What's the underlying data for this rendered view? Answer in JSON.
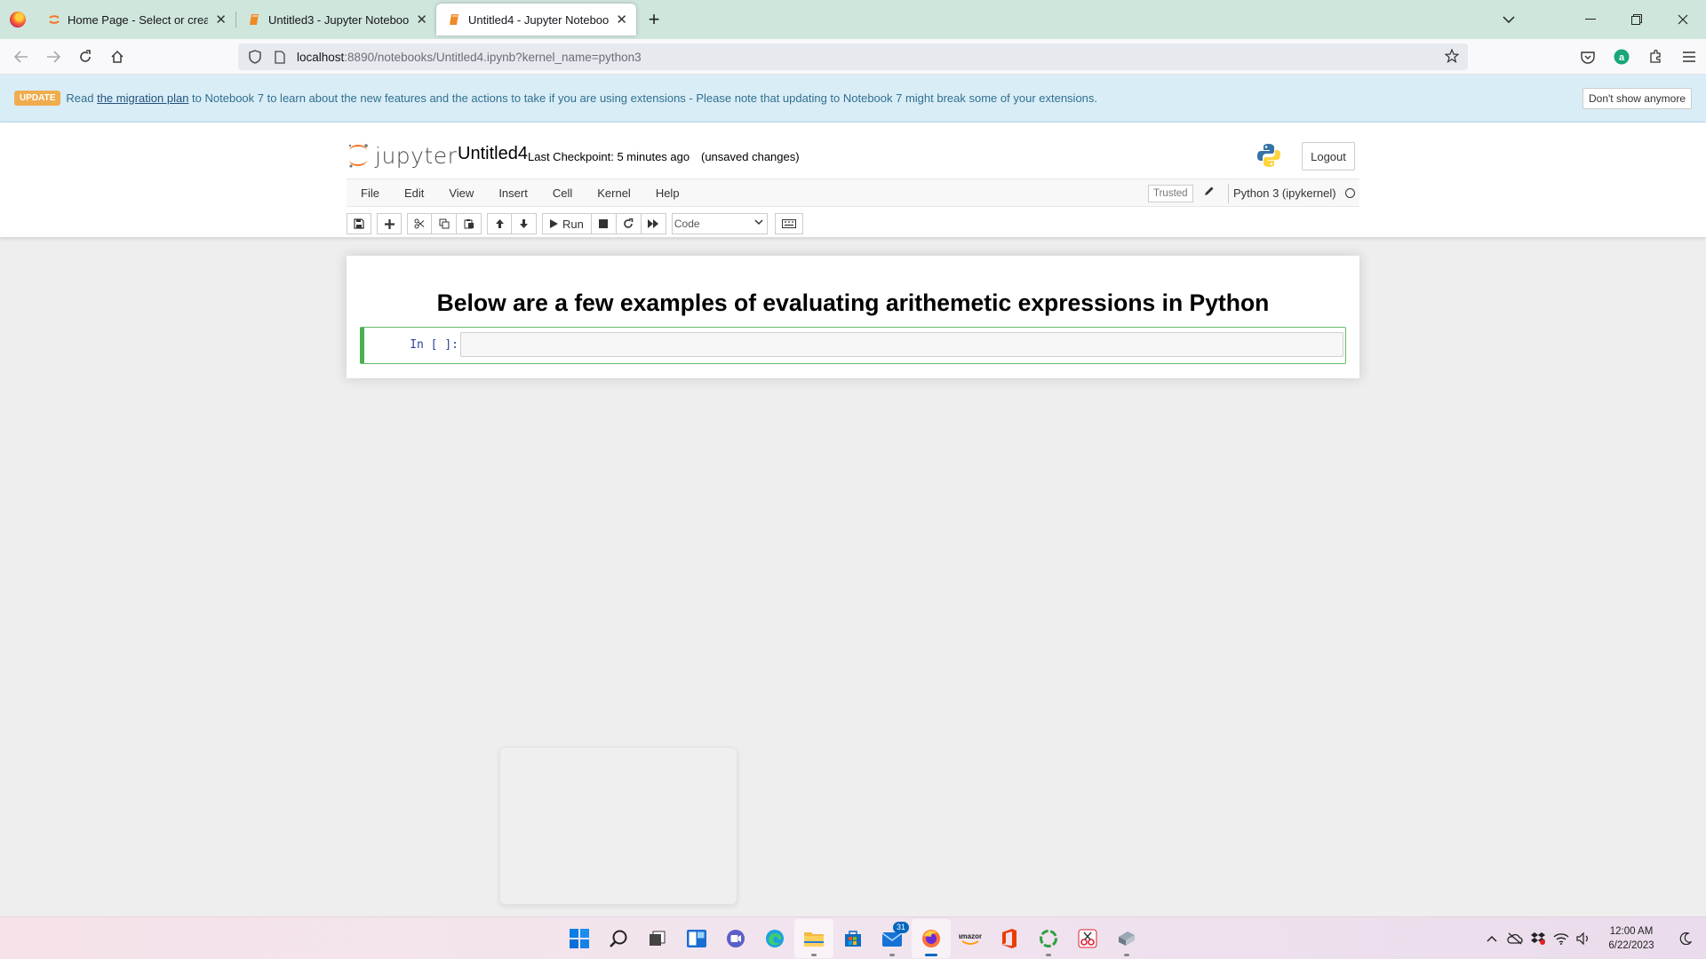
{
  "browser": {
    "tabs": [
      {
        "label": "Home Page - Select or create a",
        "active": false
      },
      {
        "label": "Untitled3 - Jupyter Notebook",
        "active": false
      },
      {
        "label": "Untitled4 - Jupyter Notebook",
        "active": true
      }
    ],
    "url_host": "localhost",
    "url_path": ":8890/notebooks/Untitled4.ipynb?kernel_name=python3"
  },
  "banner": {
    "badge": "UPDATE",
    "text_prefix": "Read",
    "link": "the migration plan",
    "text_suffix": "to Notebook 7 to learn about the new features and the actions to take if you are using extensions - Please note that updating to Notebook 7 might break some of your extensions.",
    "dismiss_label": "Don't show anymore"
  },
  "header": {
    "logo_text": "jupyter",
    "notebook_name": "Untitled4",
    "checkpoint": "Last Checkpoint: 5 minutes ago",
    "autosave": "(unsaved changes)",
    "logout_label": "Logout"
  },
  "menu": {
    "items": [
      "File",
      "Edit",
      "View",
      "Insert",
      "Cell",
      "Kernel",
      "Help"
    ],
    "trusted": "Trusted",
    "kernel_name": "Python 3 (ipykernel)"
  },
  "toolbar": {
    "run_label": "Run",
    "cell_type": "Code"
  },
  "notebook": {
    "heading": "Below are a few examples of evaluating arithemetic expressions in Python",
    "prompt": "In [ ]:"
  },
  "taskbar": {
    "mail_badge": "31",
    "time": "12:00 AM",
    "date": "6/22/2023"
  },
  "colors": {
    "tab_strip": "#cfe6dc",
    "banner_bg": "#d9edf7",
    "update_badge": "#f0ad4e",
    "cell_selected": "#4caf50",
    "prompt_in": "#303f9f"
  }
}
